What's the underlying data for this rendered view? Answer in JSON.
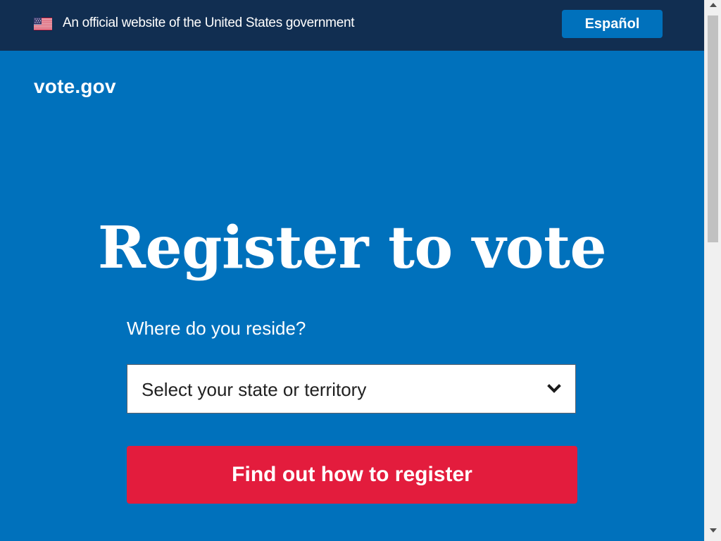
{
  "gov_banner": {
    "text": "An official website of the United States government",
    "language_button": "Español",
    "flag_icon": "us-flag-icon"
  },
  "header": {
    "logo": "vote.gov"
  },
  "hero": {
    "title": "Register to vote",
    "reside_label": "Where do you reside?",
    "state_select": {
      "selected": "Select your state or territory",
      "icon": "chevron-down-icon"
    },
    "register_button": "Find out how to register"
  },
  "colors": {
    "banner_bg": "#112e51",
    "page_bg": "#0071bc",
    "button_blue": "#0071bc",
    "button_red": "#e31c3d",
    "text_white": "#ffffff"
  }
}
